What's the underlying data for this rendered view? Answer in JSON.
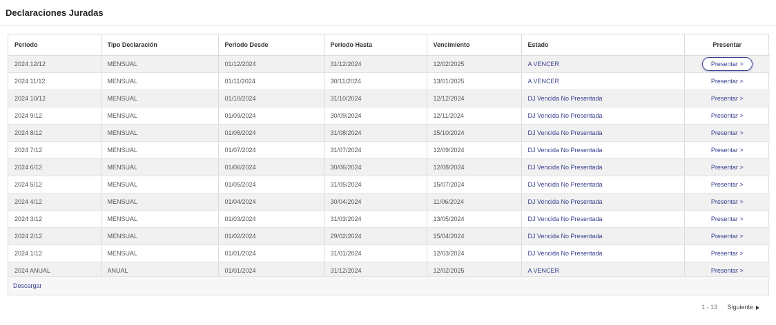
{
  "page": {
    "title": "Declaraciones Juradas"
  },
  "table": {
    "columns": [
      "Periodo",
      "Tipo Declaración",
      "Periodo Desde",
      "Periodo Hasta",
      "Vencimiento",
      "Estado",
      "Presentar"
    ],
    "rows": [
      {
        "periodo": "2024 12/12",
        "tipo": "MENSUAL",
        "desde": "01/12/2024",
        "hasta": "31/12/2024",
        "vencimiento": "12/02/2025",
        "estado": "A VENCER",
        "accion": "Presentar >"
      },
      {
        "periodo": "2024 11/12",
        "tipo": "MENSUAL",
        "desde": "01/11/2024",
        "hasta": "30/11/2024",
        "vencimiento": "13/01/2025",
        "estado": "A VENCER",
        "accion": "Presentar >"
      },
      {
        "periodo": "2024 10/12",
        "tipo": "MENSUAL",
        "desde": "01/10/2024",
        "hasta": "31/10/2024",
        "vencimiento": "12/12/2024",
        "estado": "DJ Vencida No Presentada",
        "accion": "Presentar >"
      },
      {
        "periodo": "2024 9/12",
        "tipo": "MENSUAL",
        "desde": "01/09/2024",
        "hasta": "30/09/2024",
        "vencimiento": "12/11/2024",
        "estado": "DJ Vencida No Presentada",
        "accion": "Presentar >"
      },
      {
        "periodo": "2024 8/12",
        "tipo": "MENSUAL",
        "desde": "01/08/2024",
        "hasta": "31/08/2024",
        "vencimiento": "15/10/2024",
        "estado": "DJ Vencida No Presentada",
        "accion": "Presentar >"
      },
      {
        "periodo": "2024 7/12",
        "tipo": "MENSUAL",
        "desde": "01/07/2024",
        "hasta": "31/07/2024",
        "vencimiento": "12/09/2024",
        "estado": "DJ Vencida No Presentada",
        "accion": "Presentar >"
      },
      {
        "periodo": "2024 6/12",
        "tipo": "MENSUAL",
        "desde": "01/06/2024",
        "hasta": "30/06/2024",
        "vencimiento": "12/08/2024",
        "estado": "DJ Vencida No Presentada",
        "accion": "Presentar >"
      },
      {
        "periodo": "2024 5/12",
        "tipo": "MENSUAL",
        "desde": "01/05/2024",
        "hasta": "31/05/2024",
        "vencimiento": "15/07/2024",
        "estado": "DJ Vencida No Presentada",
        "accion": "Presentar >"
      },
      {
        "periodo": "2024 4/12",
        "tipo": "MENSUAL",
        "desde": "01/04/2024",
        "hasta": "30/04/2024",
        "vencimiento": "11/06/2024",
        "estado": "DJ Vencida No Presentada",
        "accion": "Presentar >"
      },
      {
        "periodo": "2024 3/12",
        "tipo": "MENSUAL",
        "desde": "01/03/2024",
        "hasta": "31/03/2024",
        "vencimiento": "13/05/2024",
        "estado": "DJ Vencida No Presentada",
        "accion": "Presentar >"
      },
      {
        "periodo": "2024 2/12",
        "tipo": "MENSUAL",
        "desde": "01/02/2024",
        "hasta": "29/02/2024",
        "vencimiento": "15/04/2024",
        "estado": "DJ Vencida No Presentada",
        "accion": "Presentar >"
      },
      {
        "periodo": "2024 1/12",
        "tipo": "MENSUAL",
        "desde": "01/01/2024",
        "hasta": "31/01/2024",
        "vencimiento": "12/03/2024",
        "estado": "DJ Vencida No Presentada",
        "accion": "Presentar >"
      },
      {
        "periodo": "2024 ANUAL",
        "tipo": "ANUAL",
        "desde": "01/01/2024",
        "hasta": "31/12/2024",
        "vencimiento": "12/02/2025",
        "estado": "A VENCER",
        "accion": "Presentar >"
      }
    ],
    "download_label": "Descargar"
  },
  "pagination": {
    "range": "1 - 13",
    "next_label": "Siguiente",
    "next_icon": "triangle-right-icon"
  },
  "colors": {
    "link": "#3a3f8f",
    "row_alt": "#f1f1f1",
    "border": "#dcdcdc"
  }
}
